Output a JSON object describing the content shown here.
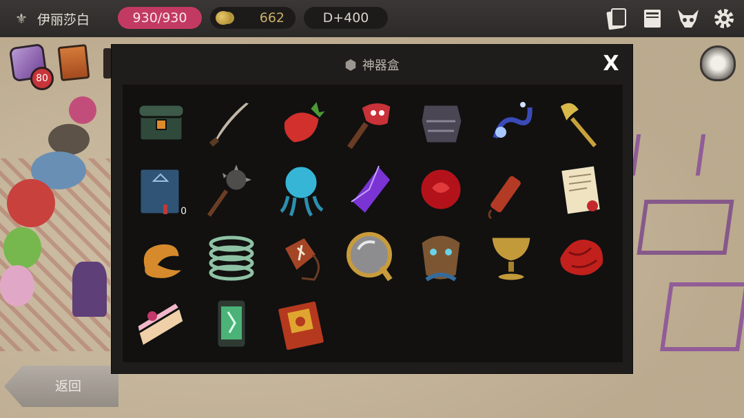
{
  "topbar": {
    "player_name": "伊丽莎白",
    "hp": "930/930",
    "gold": "662",
    "day": "D+400"
  },
  "side": {
    "dice_badge": "80"
  },
  "back_button": {
    "label": "返回"
  },
  "modal": {
    "title": "神器盒",
    "close_label": "X",
    "items": [
      {
        "name": "treasure-chest",
        "count": ""
      },
      {
        "name": "curved-blade",
        "count": ""
      },
      {
        "name": "strawberry",
        "count": ""
      },
      {
        "name": "demon-axe",
        "count": ""
      },
      {
        "name": "dark-armor",
        "count": ""
      },
      {
        "name": "blue-serpent-staff",
        "count": ""
      },
      {
        "name": "golden-scepter",
        "count": ""
      },
      {
        "name": "blue-tome",
        "count": "0"
      },
      {
        "name": "spiked-mace",
        "count": ""
      },
      {
        "name": "blue-jellyfish",
        "count": ""
      },
      {
        "name": "purple-crystal",
        "count": ""
      },
      {
        "name": "red-rose",
        "count": ""
      },
      {
        "name": "dynamite-stick",
        "count": ""
      },
      {
        "name": "scroll-letter",
        "count": ""
      },
      {
        "name": "golden-serpent",
        "count": ""
      },
      {
        "name": "green-spring",
        "count": ""
      },
      {
        "name": "rune-amulet",
        "count": ""
      },
      {
        "name": "hand-mirror",
        "count": ""
      },
      {
        "name": "wooden-mask",
        "count": ""
      },
      {
        "name": "golden-chalice",
        "count": ""
      },
      {
        "name": "red-cloth",
        "count": ""
      },
      {
        "name": "cake-slice",
        "count": ""
      },
      {
        "name": "green-capsule",
        "count": ""
      },
      {
        "name": "red-spellbook",
        "count": ""
      }
    ]
  }
}
